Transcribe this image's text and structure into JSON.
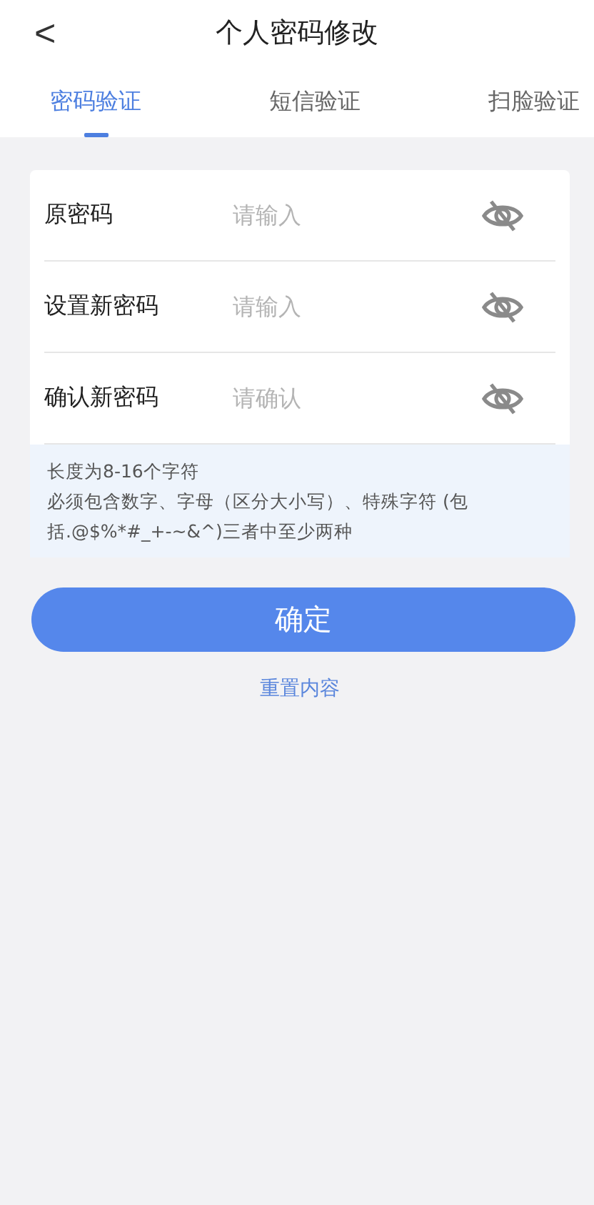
{
  "header": {
    "back": "<",
    "title": "个人密码修改"
  },
  "tabs": [
    {
      "label": "密码验证",
      "selected": true
    },
    {
      "label": "短信验证",
      "selected": false
    },
    {
      "label": "扫脸验证",
      "selected": false
    }
  ],
  "fields": [
    {
      "label": "原密码",
      "placeholder": "请输入"
    },
    {
      "label": "设置新密码",
      "placeholder": "请输入"
    },
    {
      "label": "确认新密码",
      "placeholder": "请确认"
    }
  ],
  "hint": [
    "长度为8-16个字符",
    "必须包含数字、字母（区分大小写）、特殊字符 (包括.@$%*#_+-~&^)三者中至少两种"
  ],
  "confirm_button": "确定",
  "reset_link": "重置内容"
}
